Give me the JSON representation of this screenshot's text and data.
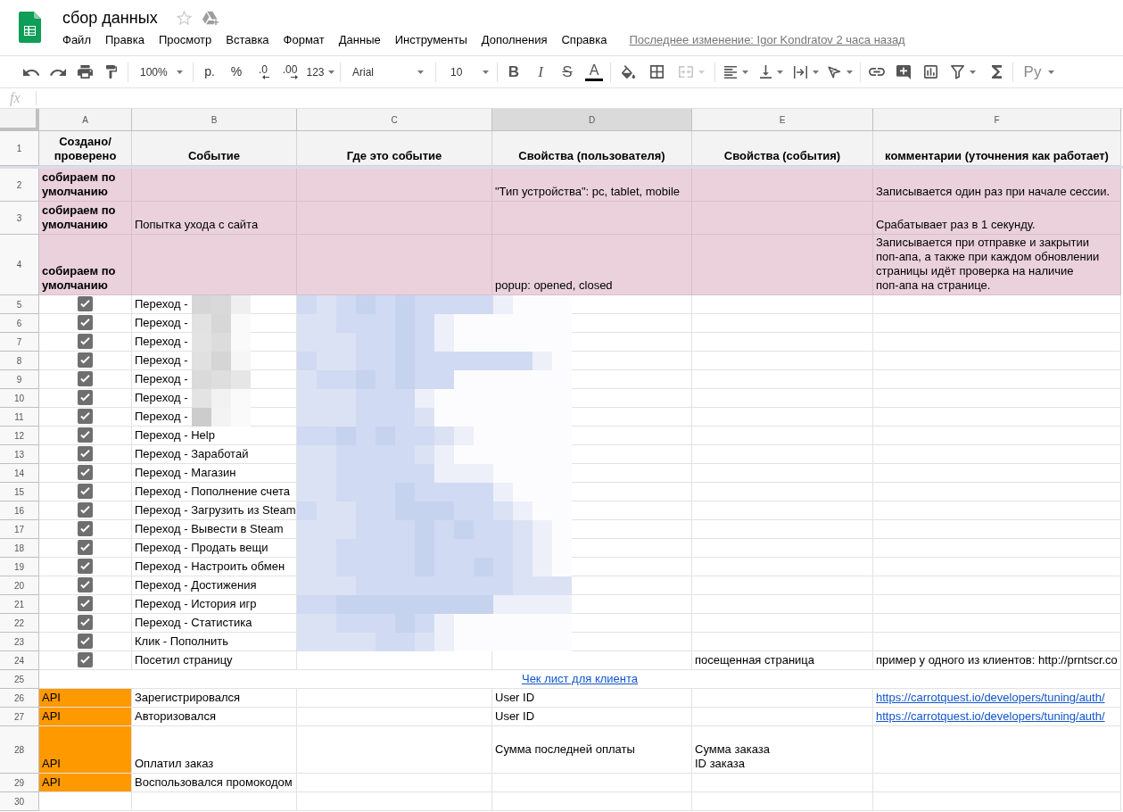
{
  "document": {
    "title": "сбор данных",
    "starred": false,
    "last_edit": "Последнее изменение: Igor Kondratov 2 часа назад"
  },
  "menu": [
    "Файл",
    "Правка",
    "Просмотр",
    "Вставка",
    "Формат",
    "Данные",
    "Инструменты",
    "Дополнения",
    "Справка"
  ],
  "toolbar": {
    "zoom": "100%",
    "currency": "р.",
    "percent": "%",
    "decimals_decrease": ".0",
    "decimals_increase": ".00",
    "number_format": "123",
    "font": "Arial",
    "font_size": "10",
    "bold": "B",
    "italic": "I",
    "strikethrough": "S",
    "text_color": "A",
    "merge_disabled": true,
    "input_tools": "Ру"
  },
  "formula_bar": {
    "label": "fx"
  },
  "sheet": {
    "columns": [
      {
        "label": "A",
        "selected": false
      },
      {
        "label": "B",
        "selected": false
      },
      {
        "label": "C",
        "selected": false
      },
      {
        "label": "D",
        "selected": true
      },
      {
        "label": "E",
        "selected": false
      },
      {
        "label": "F",
        "selected": false
      }
    ],
    "header_row": {
      "number": "1",
      "titles": [
        "Создано/ проверено",
        "Событие",
        "Где это событие",
        "Свойства (пользователя)",
        "Свойства (события)",
        "комментарии (уточнения как работает)"
      ]
    },
    "rows": [
      {
        "number": "2",
        "kind": "data",
        "color": "#ead1dc",
        "created": {
          "text": "собираем по умолчанию",
          "bold": true
        },
        "user_properties": {
          "text": "\"Тип устройства\": pc, tablet, mobile"
        },
        "comments": {
          "text": "Записывается один раз при начале сессии."
        }
      },
      {
        "number": "3",
        "kind": "data",
        "color": "#ead1dc",
        "created": {
          "text": "собираем по умолчанию",
          "bold": true
        },
        "event": {
          "text": "Попытка ухода с сайта"
        },
        "comments": {
          "text": "Срабатывает раз в 1 секунду."
        }
      },
      {
        "number": "4",
        "kind": "data",
        "color": "#ead1dc",
        "created": {
          "text": "собираем по умолчанию",
          "bold": true
        },
        "user_properties": {
          "text": "popup: opened, closed"
        },
        "comments": {
          "text": "Записывается при отправке и закрытии поп-апа, а также при каждом обновлении страницы идёт проверка на наличие поп-апа на странице."
        }
      },
      {
        "number": "5",
        "kind": "data",
        "created": {
          "kind": "checkbox",
          "checked": true
        },
        "event": {
          "text": "Переход -"
        }
      },
      {
        "number": "6",
        "kind": "data",
        "created": {
          "kind": "checkbox",
          "checked": true
        },
        "event": {
          "text": "Переход -"
        }
      },
      {
        "number": "7",
        "kind": "data",
        "created": {
          "kind": "checkbox",
          "checked": true
        },
        "event": {
          "text": "Переход -"
        }
      },
      {
        "number": "8",
        "kind": "data",
        "created": {
          "kind": "checkbox",
          "checked": true
        },
        "event": {
          "text": "Переход -"
        }
      },
      {
        "number": "9",
        "kind": "data",
        "created": {
          "kind": "checkbox",
          "checked": true
        },
        "event": {
          "text": "Переход -"
        }
      },
      {
        "number": "10",
        "kind": "data",
        "created": {
          "kind": "checkbox",
          "checked": true
        },
        "event": {
          "text": "Переход -"
        }
      },
      {
        "number": "11",
        "kind": "data",
        "created": {
          "kind": "checkbox",
          "checked": true
        },
        "event": {
          "text": "Переход -"
        }
      },
      {
        "number": "12",
        "kind": "data",
        "created": {
          "kind": "checkbox",
          "checked": true
        },
        "event": {
          "text": "Переход - Help"
        }
      },
      {
        "number": "13",
        "kind": "data",
        "created": {
          "kind": "checkbox",
          "checked": true
        },
        "event": {
          "text": "Переход - Заработай"
        }
      },
      {
        "number": "14",
        "kind": "data",
        "created": {
          "kind": "checkbox",
          "checked": true
        },
        "event": {
          "text": "Переход - Магазин"
        }
      },
      {
        "number": "15",
        "kind": "data",
        "created": {
          "kind": "checkbox",
          "checked": true
        },
        "event": {
          "text": "Переход - Пополнение счета"
        }
      },
      {
        "number": "16",
        "kind": "data",
        "created": {
          "kind": "checkbox",
          "checked": true
        },
        "event": {
          "text": "Переход - Загрузить из Steam"
        }
      },
      {
        "number": "17",
        "kind": "data",
        "created": {
          "kind": "checkbox",
          "checked": true
        },
        "event": {
          "text": "Переход - Вывести в Steam"
        }
      },
      {
        "number": "18",
        "kind": "data",
        "created": {
          "kind": "checkbox",
          "checked": true
        },
        "event": {
          "text": "Переход - Продать вещи"
        }
      },
      {
        "number": "19",
        "kind": "data",
        "created": {
          "kind": "checkbox",
          "checked": true
        },
        "event": {
          "text": "Переход - Настроить обмен"
        }
      },
      {
        "number": "20",
        "kind": "data",
        "created": {
          "kind": "checkbox",
          "checked": true
        },
        "event": {
          "text": "Переход - Достижения"
        }
      },
      {
        "number": "21",
        "kind": "data",
        "created": {
          "kind": "checkbox",
          "checked": true
        },
        "event": {
          "text": "Переход - История игр"
        }
      },
      {
        "number": "22",
        "kind": "data",
        "created": {
          "kind": "checkbox",
          "checked": true
        },
        "event": {
          "text": "Переход - Статистика"
        }
      },
      {
        "number": "23",
        "kind": "data",
        "created": {
          "kind": "checkbox",
          "checked": true
        },
        "event": {
          "text": "Клик - Пополнить"
        }
      },
      {
        "number": "24",
        "kind": "data",
        "created": {
          "kind": "checkbox",
          "checked": true
        },
        "event": {
          "text": "Посетил страницу"
        },
        "event_properties": {
          "text": "посещенная страница"
        },
        "comments": {
          "text": "пример у одного из клиентов: http://prntscr.co"
        }
      },
      {
        "number": "25",
        "kind": "merged",
        "link": "Чек лист для клиента"
      },
      {
        "number": "26",
        "kind": "data",
        "created": {
          "text": "API",
          "color": "#ff9900"
        },
        "event": {
          "text": "Зарегистрировался"
        },
        "user_properties": {
          "text": "User ID"
        },
        "comments": {
          "kind": "link",
          "text": "https://carrotquest.io/developers/tuning/auth/"
        }
      },
      {
        "number": "27",
        "kind": "data",
        "created": {
          "text": "API",
          "color": "#ff9900"
        },
        "event": {
          "text": "Авторизовался"
        },
        "user_properties": {
          "text": "User ID"
        },
        "comments": {
          "kind": "link",
          "text": "https://carrotquest.io/developers/tuning/auth/"
        }
      },
      {
        "number": "28",
        "kind": "data",
        "created": {
          "text": "API",
          "color": "#ff9900"
        },
        "event": {
          "text": "Оплатил заказ"
        },
        "user_properties": {
          "text": "Сумма последней оплаты",
          "vertically_centered": true
        },
        "event_properties": {
          "text": "Сумма заказа\nID заказа"
        }
      },
      {
        "number": "29",
        "kind": "data",
        "created": {
          "text": "API",
          "color": "#ff9900"
        },
        "event": {
          "text": "Воспользовался промокодом"
        }
      },
      {
        "number": "30",
        "kind": "data"
      }
    ]
  }
}
